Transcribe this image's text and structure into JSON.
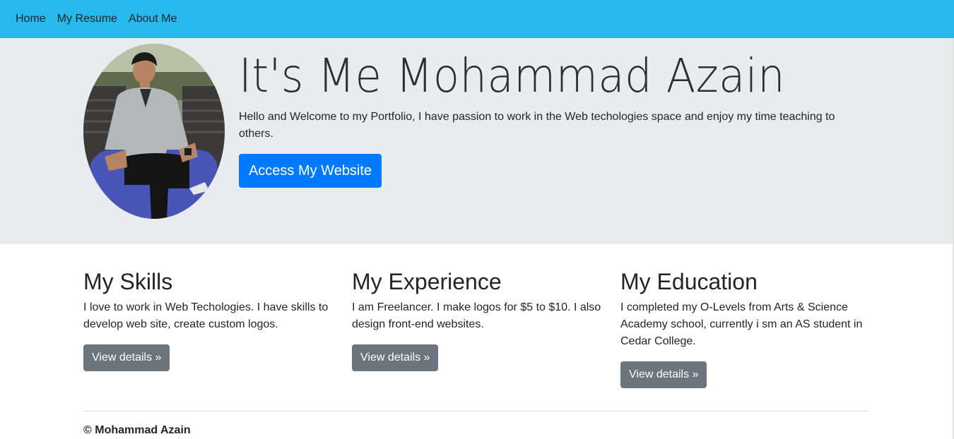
{
  "nav": {
    "items": [
      "Home",
      "My Resume",
      "About Me"
    ]
  },
  "hero": {
    "title": "It's Me Mohammad Azain",
    "text": "Hello and Welcome to my Portfolio, I have passion to work in the Web techologies space and enjoy my time teaching to others.",
    "button": "Access My Website",
    "avatar_alt": "profile-photo"
  },
  "sections": [
    {
      "title": "My Skills",
      "text": "I love to work in Web Techologies. I have skills to develop web site, create custom logos.",
      "button": "View details »"
    },
    {
      "title": "My Experience",
      "text": "I am Freelancer. I make logos for $5 to $10. I also design front-end websites.",
      "button": "View details »"
    },
    {
      "title": "My Education",
      "text": "I completed my O-Levels from Arts & Science Academy school, currently i sm an AS student in Cedar College.",
      "button": "View details »"
    }
  ],
  "footer": {
    "text": "© Mohammad Azain"
  },
  "colors": {
    "navbar": "#27b9eb",
    "jumbotron": "#e9ecef",
    "primary": "#007bff",
    "secondary": "#6c757d"
  }
}
